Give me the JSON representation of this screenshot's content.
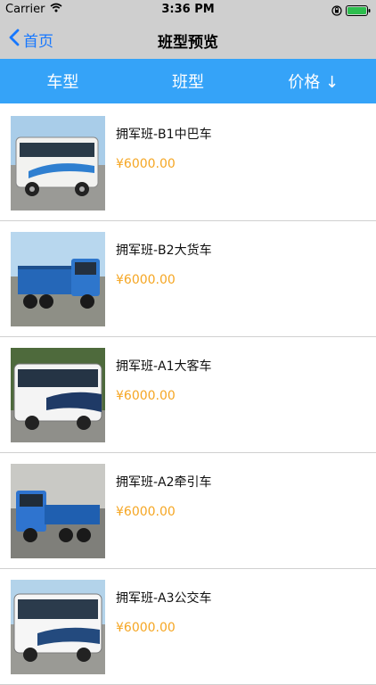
{
  "status": {
    "carrier": "Carrier",
    "time": "3:36 PM"
  },
  "nav": {
    "back_label": "首页",
    "title": "班型预览"
  },
  "tabs": [
    {
      "label": "车型"
    },
    {
      "label": "班型"
    },
    {
      "label": "价格 ↓"
    }
  ],
  "items": [
    {
      "name": "拥军班-B1中巴车",
      "price": "¥6000.00",
      "image": "minibus"
    },
    {
      "name": "拥军班-B2大货车",
      "price": "¥6000.00",
      "image": "truck"
    },
    {
      "name": "拥军班-A1大客车",
      "price": "¥6000.00",
      "image": "coach"
    },
    {
      "name": "拥军班-A2牵引车",
      "price": "¥6000.00",
      "image": "tractor-truck"
    },
    {
      "name": "拥军班-A3公交车",
      "price": "¥6000.00",
      "image": "bus"
    }
  ]
}
